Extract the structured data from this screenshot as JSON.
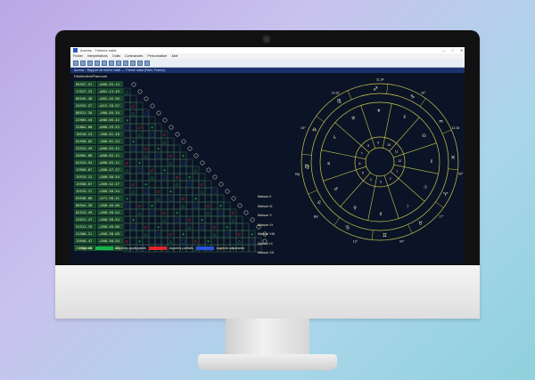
{
  "window": {
    "title": "Aureas - Thèmes natal",
    "buttons": [
      "—",
      "□",
      "✕"
    ]
  },
  "menu": [
    "Fichier",
    "Interprétations",
    "Outils",
    "Commandes",
    "Personnaliser",
    "Aide"
  ],
  "infobar": "Aureas - Rapport de thème natal — Thème natal (Paris, France)",
  "aspect_grid": {
    "title": "Distribution/Parcours",
    "rows": [
      [
        "05557.51",
        "+060.55.14"
      ],
      [
        "17527.23",
        "+001.13.49"
      ],
      [
        "06545.48",
        "+001.45.56"
      ],
      [
        "24532.27",
        "+012.18.57"
      ],
      [
        "08521.26",
        "-000.05.34"
      ],
      [
        "22905.44",
        "+000.05.42"
      ],
      [
        "22804.08",
        "+000.29.53"
      ],
      [
        "10910.24",
        "-000.01.40"
      ],
      [
        "01558.02",
        "-000.01.24"
      ],
      [
        "22524.49",
        "+000.03.42"
      ],
      [
        "20904.06",
        "+000.03.11"
      ],
      [
        "02524.54",
        "+000.03.11"
      ],
      [
        "13950.07",
        "+360.47.27"
      ],
      [
        "15515.12",
        "+360.58.54"
      ],
      [
        "15558.07",
        "+360.42.57"
      ],
      [
        "15515.17",
        "+360.58.54"
      ],
      [
        "03548.06",
        "+371.58.41"
      ],
      [
        "06944.30",
        "+360.46.06"
      ],
      [
        "02515.49",
        "+360.58.54"
      ],
      [
        "23521.47",
        "+360.58.54"
      ],
      [
        "21511.19",
        "+360.48.06"
      ],
      [
        "21500.21",
        "+360.58.09"
      ],
      [
        "13940.47",
        "+360.58.54"
      ],
      [
        "21511.19",
        "+360.48.07"
      ]
    ],
    "points": [
      "Asc",
      "MC",
      "Dsc",
      "Maison II",
      "Maison III",
      "Maison V",
      "Maison VI",
      "Maison VIII",
      "Maison IX",
      "Maison XII"
    ],
    "legend": {
      "label": "Légende",
      "applying": "Aspects appliquants",
      "exact": "Aspects parfaits",
      "separating": "Aspects séparants",
      "colors": {
        "applying": "#19b34a",
        "exact": "#e0262b",
        "separating": "#2a54d8"
      }
    }
  },
  "wheel": {
    "outer_labels": [
      "11.24",
      "20°",
      "12.34",
      "09°",
      "17°",
      "04°",
      "13°",
      "Bél",
      "Sag",
      "29°",
      "14.22"
    ],
    "colors": {
      "ring": "#c8c850",
      "background": "#0b1326"
    }
  }
}
